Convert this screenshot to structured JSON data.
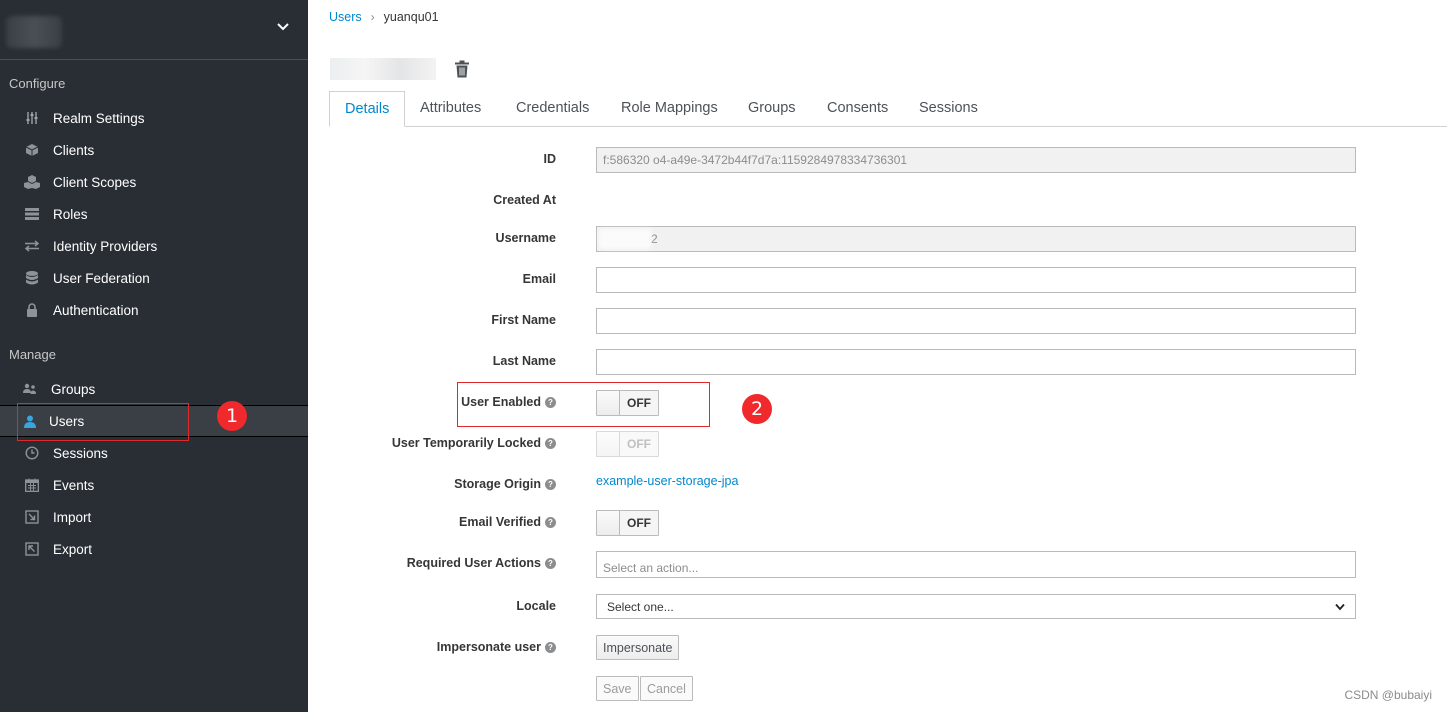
{
  "sidebar": {
    "configure_title": "Configure",
    "manage_title": "Manage",
    "configure_items": [
      {
        "label": "Realm Settings",
        "icon": "sliders-icon"
      },
      {
        "label": "Clients",
        "icon": "cube-icon"
      },
      {
        "label": "Client Scopes",
        "icon": "cubes-icon"
      },
      {
        "label": "Roles",
        "icon": "list-icon"
      },
      {
        "label": "Identity Providers",
        "icon": "exchange-icon"
      },
      {
        "label": "User Federation",
        "icon": "database-icon"
      },
      {
        "label": "Authentication",
        "icon": "lock-icon"
      }
    ],
    "manage_items": [
      {
        "label": "Groups",
        "icon": "users-icon"
      },
      {
        "label": "Users",
        "icon": "user-icon"
      },
      {
        "label": "Sessions",
        "icon": "clock-icon"
      },
      {
        "label": "Events",
        "icon": "calendar-icon"
      },
      {
        "label": "Import",
        "icon": "import-icon"
      },
      {
        "label": "Export",
        "icon": "export-icon"
      }
    ]
  },
  "annotations": {
    "one": "1",
    "two": "2"
  },
  "breadcrumb": {
    "parent": "Users",
    "current": "yuanqu01"
  },
  "tabs": [
    "Details",
    "Attributes",
    "Credentials",
    "Role Mappings",
    "Groups",
    "Consents",
    "Sessions"
  ],
  "form": {
    "id_label": "ID",
    "id_value": "f:586320            o4-a49e-3472b44f7d7a:1159284978334736301",
    "created_label": "Created At",
    "username_label": "Username",
    "username_value": "2",
    "email_label": "Email",
    "first_name_label": "First Name",
    "last_name_label": "Last Name",
    "user_enabled_label": "User Enabled",
    "user_enabled_state": "OFF",
    "temp_locked_label": "User Temporarily Locked",
    "temp_locked_state": "OFF",
    "storage_origin_label": "Storage Origin",
    "storage_origin_value": "example-user-storage-jpa",
    "email_verified_label": "Email Verified",
    "email_verified_state": "OFF",
    "required_actions_label": "Required User Actions",
    "required_actions_placeholder": "Select an action...",
    "locale_label": "Locale",
    "locale_value": "Select one...",
    "impersonate_label": "Impersonate user",
    "impersonate_button": "Impersonate",
    "save_button": "Save",
    "cancel_button": "Cancel"
  },
  "watermark": "CSDN @bubaiyi",
  "colors": {
    "sidebar_bg": "#292e34",
    "link": "#0088ce",
    "annotation_red": "#f0292c"
  }
}
